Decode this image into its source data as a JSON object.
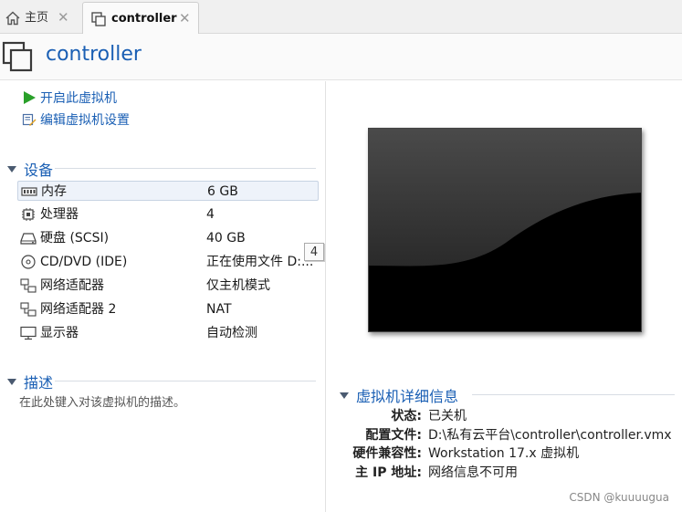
{
  "tabs": [
    {
      "label": "主页",
      "close": "✕"
    },
    {
      "label": "controller",
      "close": "✕"
    }
  ],
  "header": {
    "title": "controller"
  },
  "actions": {
    "power_on": "开启此虚拟机",
    "edit_settings": "编辑虚拟机设置"
  },
  "devices": {
    "heading": "设备",
    "rows": [
      {
        "name": "内存",
        "value": "6 GB",
        "icon": "memory-icon"
      },
      {
        "name": "处理器",
        "value": "4",
        "icon": "processor-icon"
      },
      {
        "name": "硬盘 (SCSI)",
        "value": "40 GB",
        "icon": "hard-disk-icon"
      },
      {
        "name": "CD/DVD (IDE)",
        "value": "正在使用文件 D:...",
        "icon": "cd-dvd-icon"
      },
      {
        "name": "网络适配器",
        "value": "仅主机模式",
        "icon": "network-adapter-icon"
      },
      {
        "name": "网络适配器 2",
        "value": "NAT",
        "icon": "network-adapter-icon"
      },
      {
        "name": "显示器",
        "value": "自动检测",
        "icon": "display-icon"
      }
    ],
    "badge": "4"
  },
  "description": {
    "heading": "描述",
    "placeholder": "在此处键入对该虚拟机的描述。"
  },
  "details": {
    "heading": "虚拟机详细信息",
    "rows": [
      {
        "key": "状态:",
        "value": "已关机"
      },
      {
        "key": "配置文件:",
        "value": "D:\\私有云平台\\controller\\controller.vmx"
      },
      {
        "key": "硬件兼容性:",
        "value": "Workstation 17.x 虚拟机"
      },
      {
        "key": "主 IP 地址:",
        "value": "网络信息不可用"
      }
    ]
  },
  "watermark": "CSDN @kuuuugua",
  "colors": {
    "accent": "#1a5fb4",
    "play": "#2aa02a"
  }
}
